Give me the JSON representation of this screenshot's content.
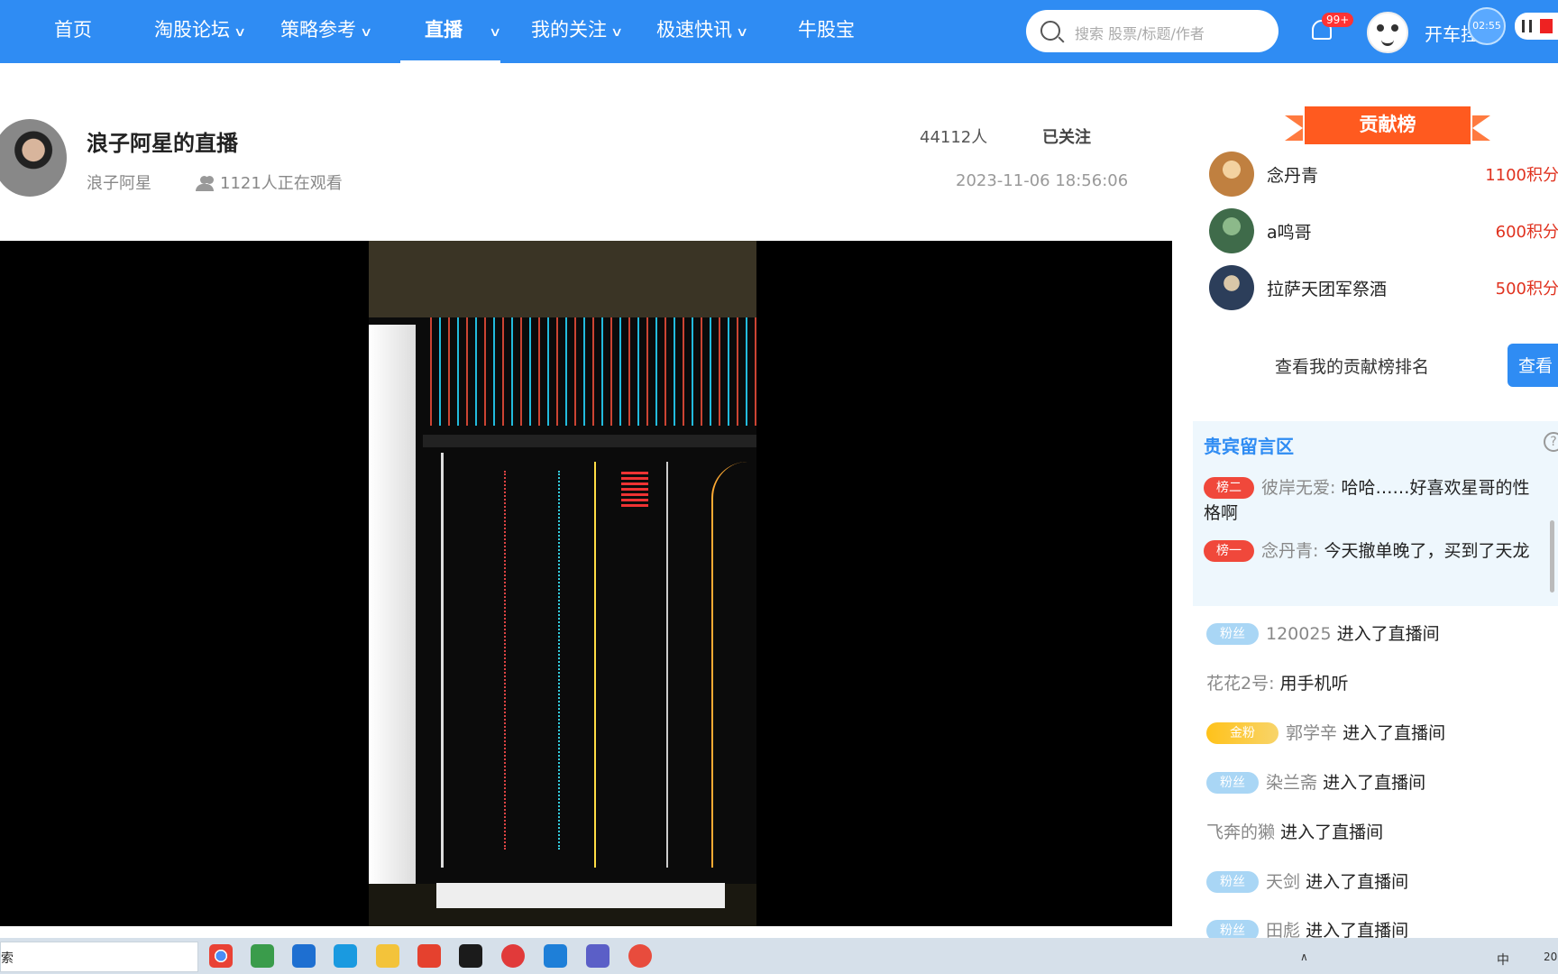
{
  "nav": {
    "items": [
      {
        "label": "首页",
        "dropdown": false,
        "active": false
      },
      {
        "label": "淘股论坛",
        "dropdown": true,
        "active": false
      },
      {
        "label": "策略参考",
        "dropdown": true,
        "active": false
      },
      {
        "label": "直播",
        "dropdown": true,
        "active": true
      },
      {
        "label": "我的关注",
        "dropdown": true,
        "active": false
      },
      {
        "label": "极速快讯",
        "dropdown": true,
        "active": false
      },
      {
        "label": "牛股宝",
        "dropdown": false,
        "active": false
      }
    ],
    "search_placeholder": "搜索 股票/标题/作者",
    "notification_badge": "99+",
    "user_name": "开车挂",
    "timer": "02:55"
  },
  "live": {
    "title": "浪子阿星的直播",
    "host": "浪子阿星",
    "viewers": "1121人正在观看",
    "fans": "44112人",
    "follow_label": "已关注",
    "datetime": "2023-11-06 18:56:06"
  },
  "contribution": {
    "banner": "贡献榜",
    "ranks": [
      {
        "name": "念丹青",
        "points": "1100积分"
      },
      {
        "name": "a鸣哥",
        "points": "600积分"
      },
      {
        "name": "拉萨天团军祭酒",
        "points": "500积分"
      }
    ],
    "my_rank_label": "查看我的贡献榜排名",
    "check_button": "查看"
  },
  "vip_area": {
    "heading": "贵宾留言区",
    "messages": [
      {
        "tag": "榜二",
        "user": "彼岸无爱:",
        "text": "哈哈……好喜欢星哥的性格啊"
      },
      {
        "tag": "榜一",
        "user": "念丹青:",
        "text": "今天撤单晚了，买到了天龙"
      }
    ]
  },
  "feed": [
    {
      "tag": "粉丝",
      "user": "120025",
      "text": "进入了直播间"
    },
    {
      "tag": "",
      "user": "花花2号:",
      "text": "用手机听"
    },
    {
      "tag": "金粉",
      "user": "郭学辛",
      "text": "进入了直播间"
    },
    {
      "tag": "粉丝",
      "user": "染兰斋",
      "text": "进入了直播间"
    },
    {
      "tag": "",
      "user": "飞奔的獭",
      "text": "进入了直播间"
    },
    {
      "tag": "粉丝",
      "user": "天剑",
      "text": "进入了直播间"
    },
    {
      "tag": "粉丝",
      "user": "田彪",
      "text": "进入了直播间"
    }
  ],
  "taskbar": {
    "search_text": "索",
    "ime": "中",
    "clock": "20"
  },
  "colors": {
    "nav_bg": "#2f8cf3",
    "accent_red": "#e0321f",
    "banner_orange": "#ff5a1f"
  }
}
